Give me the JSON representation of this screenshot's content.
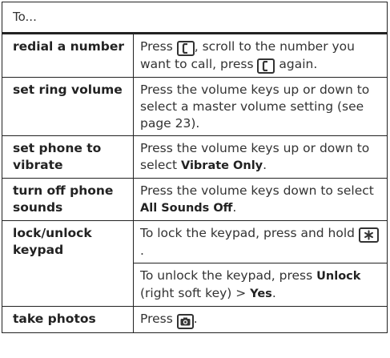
{
  "header": {
    "label": "To..."
  },
  "rows": [
    {
      "task": "redial a number",
      "paragraphs": [
        [
          {
            "t": "text",
            "v": "Press "
          },
          {
            "t": "icon",
            "v": "send-key-icon"
          },
          {
            "t": "text",
            "v": ", scroll to the number you want to call, press "
          },
          {
            "t": "icon",
            "v": "send-key-icon"
          },
          {
            "t": "text",
            "v": " again."
          }
        ]
      ]
    },
    {
      "task": "set ring volume",
      "paragraphs": [
        [
          {
            "t": "text",
            "v": "Press the volume keys up or down to select a master volume setting (see page 23)."
          }
        ]
      ]
    },
    {
      "task": "set phone to vibrate",
      "paragraphs": [
        [
          {
            "t": "text",
            "v": "Press the volume keys up or down to select "
          },
          {
            "t": "bold",
            "v": "Vibrate Only"
          },
          {
            "t": "text",
            "v": "."
          }
        ]
      ]
    },
    {
      "task": "turn off phone sounds",
      "paragraphs": [
        [
          {
            "t": "text",
            "v": "Press the volume keys down to select "
          },
          {
            "t": "bold",
            "v": "All Sounds Off"
          },
          {
            "t": "text",
            "v": "."
          }
        ]
      ]
    },
    {
      "task": "lock/unlock keypad",
      "paragraphs": [
        [
          {
            "t": "text",
            "v": "To lock the keypad, press and hold "
          },
          {
            "t": "icon",
            "v": "star-key-icon"
          },
          {
            "t": "text",
            "v": "."
          }
        ],
        [
          {
            "t": "text",
            "v": "To unlock the keypad, press "
          },
          {
            "t": "bold",
            "v": "Unlock"
          },
          {
            "t": "text",
            "v": " (right soft key) > "
          },
          {
            "t": "bold",
            "v": "Yes"
          },
          {
            "t": "text",
            "v": "."
          }
        ]
      ]
    },
    {
      "task": "take photos",
      "paragraphs": [
        [
          {
            "t": "text",
            "v": "Press "
          },
          {
            "t": "icon",
            "v": "camera-key-icon"
          },
          {
            "t": "text",
            "v": "."
          }
        ]
      ]
    }
  ]
}
